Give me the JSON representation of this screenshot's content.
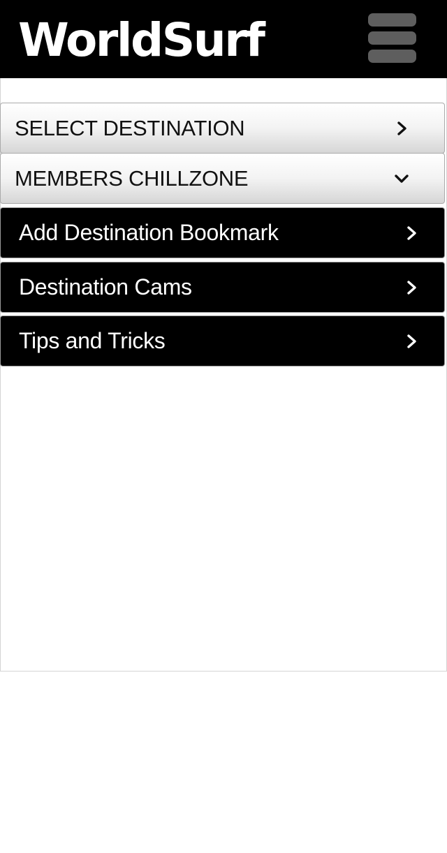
{
  "header": {
    "title": "WorldSurf",
    "menu_icon": "hamburger-menu-icon",
    "background_color": "#000000"
  },
  "menu": {
    "select_destination": {
      "label": "SELECT DESTINATION",
      "icon": "chevron-right-icon"
    },
    "members_chillzone": {
      "label": "MEMBERS CHILLZONE",
      "icon": "chevron-down-icon",
      "expanded": true
    },
    "submenu": [
      {
        "label": "Add Destination Bookmark",
        "icon": "chevron-right-icon"
      },
      {
        "label": "Destination Cams",
        "icon": "chevron-right-icon"
      },
      {
        "label": "Tips and Tricks",
        "icon": "chevron-right-icon"
      }
    ]
  }
}
